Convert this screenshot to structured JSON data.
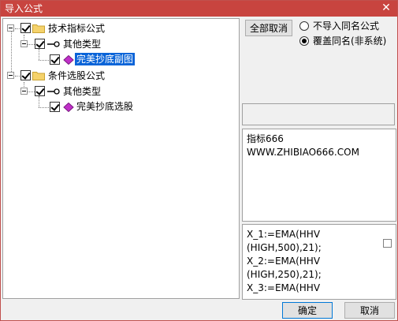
{
  "window": {
    "title": "导入公式",
    "close_glyph": "✕"
  },
  "tree": {
    "nodes": [
      {
        "label": "技术指标公式",
        "checked": true
      },
      {
        "label": "其他类型",
        "checked": true
      },
      {
        "label": "完美抄底副图",
        "checked": true,
        "selected": true
      },
      {
        "label": "条件选股公式",
        "checked": true
      },
      {
        "label": "其他类型",
        "checked": true
      },
      {
        "label": "完美抄底选股",
        "checked": true
      }
    ]
  },
  "options": {
    "deselect_all_label": "全部取消",
    "radio_no_import": "不导入同名公式",
    "radio_overwrite": "覆盖同名(非系统)",
    "selected_radio": "overwrite"
  },
  "info": {
    "lines": [
      "指标666",
      "WWW.ZHIBIAO666.COM"
    ]
  },
  "code": {
    "lines": [
      "X_1:=EMA(HHV",
      "(HIGH,500),21);",
      "X_2:=EMA(HHV",
      "(HIGH,250),21);",
      "X_3:=EMA(HHV"
    ]
  },
  "footer": {
    "ok_label": "确定",
    "cancel_label": "取消"
  },
  "colors": {
    "titlebar": "#c8443f",
    "selection": "#0a64d8",
    "folder": "#f5d26b"
  }
}
